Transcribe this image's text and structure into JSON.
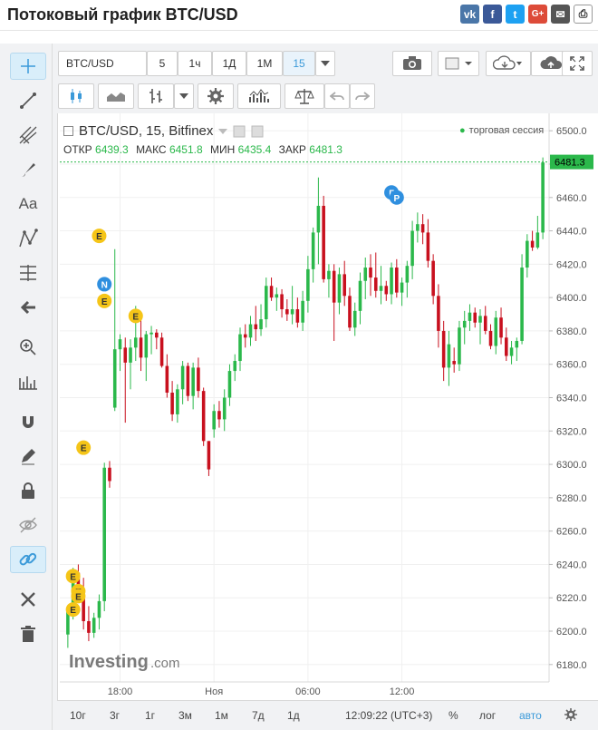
{
  "page_title": "Потоковый график BTC/USD",
  "share_icons": [
    "vk-icon",
    "facebook-icon",
    "twitter-icon",
    "google-plus-icon",
    "email-icon",
    "print-icon"
  ],
  "share_labels": {
    "vk": "vk",
    "fb": "f",
    "tw": "t",
    "gp": "G+",
    "em": "✉",
    "pr": "⎙"
  },
  "toolbar": {
    "symbol": "BTC/USD",
    "intervals": [
      "5",
      "1ч",
      "1Д",
      "1М",
      "15"
    ],
    "selected_interval": "15"
  },
  "legend": {
    "title": "BTC/USD, 15, Bitfinex",
    "open_label": "ОТКР",
    "open": "6439.3",
    "high_label": "МАКС",
    "high": "6451.8",
    "low_label": "МИН",
    "low": "6435.4",
    "close_label": "ЗАКР",
    "close": "6481.3",
    "session": "торговая сессия"
  },
  "watermark": {
    "brand": "Investing",
    "suffix": ".com"
  },
  "bottom_bar": {
    "ranges": [
      "10г",
      "3г",
      "1г",
      "3м",
      "1м",
      "7д",
      "1д"
    ],
    "time": "12:09:22 (UTC+3)",
    "percent": "%",
    "log": "лог",
    "auto": "авто"
  },
  "colors": {
    "up": "#2bb84b",
    "down": "#c8101e",
    "accent": "#3b9ad9",
    "event": "#f5c518",
    "news": "#2f8fdf"
  },
  "chart_data": {
    "type": "candlestick",
    "ylim": [
      6175,
      6505
    ],
    "y_ticks": [
      "6500.0",
      "6480.0",
      "6460.0",
      "6440.0",
      "6420.0",
      "6400.0",
      "6380.0",
      "6360.0",
      "6340.0",
      "6320.0",
      "6300.0",
      "6280.0",
      "6260.0",
      "6240.0",
      "6220.0",
      "6200.0",
      "6180.0"
    ],
    "x_ticks": [
      {
        "i": 10,
        "label": "18:00"
      },
      {
        "i": 28,
        "label": "Ноя"
      },
      {
        "i": 46,
        "label": "06:00"
      },
      {
        "i": 64,
        "label": "12:00"
      }
    ],
    "last_price": "6481.3",
    "candles": [
      [
        6198,
        6215,
        6190,
        6212
      ],
      [
        6212,
        6238,
        6207,
        6235
      ],
      [
        6235,
        6240,
        6218,
        6222
      ],
      [
        6222,
        6232,
        6201,
        6206
      ],
      [
        6206,
        6215,
        6194,
        6199
      ],
      [
        6199,
        6211,
        6196,
        6208
      ],
      [
        6208,
        6222,
        6201,
        6218
      ],
      [
        6218,
        6301,
        6212,
        6298
      ],
      [
        6298,
        6302,
        6286,
        6290
      ],
      [
        6334,
        6429,
        6332,
        6369
      ],
      [
        6369,
        6378,
        6356,
        6375
      ],
      [
        6370,
        6376,
        6325,
        6361
      ],
      [
        6361,
        6375,
        6345,
        6370
      ],
      [
        6370,
        6395,
        6362,
        6376
      ],
      [
        6376,
        6387,
        6356,
        6364
      ],
      [
        6364,
        6380,
        6350,
        6378
      ],
      [
        6378,
        6383,
        6366,
        6379
      ],
      [
        6379,
        6381,
        6369,
        6376
      ],
      [
        6376,
        6379,
        6358,
        6359
      ],
      [
        6359,
        6366,
        6340,
        6343
      ],
      [
        6343,
        6350,
        6326,
        6330
      ],
      [
        6330,
        6348,
        6325,
        6345
      ],
      [
        6345,
        6362,
        6336,
        6359
      ],
      [
        6359,
        6361,
        6338,
        6341
      ],
      [
        6341,
        6361,
        6333,
        6358
      ],
      [
        6358,
        6364,
        6340,
        6344
      ],
      [
        6344,
        6346,
        6311,
        6314
      ],
      [
        6314,
        6314,
        6293,
        6297
      ],
      [
        6321,
        6336,
        6316,
        6332
      ],
      [
        6332,
        6338,
        6322,
        6327
      ],
      [
        6327,
        6345,
        6320,
        6340
      ],
      [
        6340,
        6360,
        6335,
        6356
      ],
      [
        6356,
        6366,
        6350,
        6362
      ],
      [
        6362,
        6382,
        6356,
        6378
      ],
      [
        6378,
        6384,
        6370,
        6376
      ],
      [
        6376,
        6389,
        6371,
        6384
      ],
      [
        6384,
        6395,
        6374,
        6381
      ],
      [
        6381,
        6396,
        6377,
        6387
      ],
      [
        6387,
        6412,
        6382,
        6407
      ],
      [
        6407,
        6412,
        6398,
        6400
      ],
      [
        6400,
        6406,
        6392,
        6402
      ],
      [
        6402,
        6405,
        6388,
        6393
      ],
      [
        6393,
        6399,
        6386,
        6390
      ],
      [
        6390,
        6407,
        6384,
        6393
      ],
      [
        6393,
        6400,
        6382,
        6385
      ],
      [
        6385,
        6404,
        6380,
        6398
      ],
      [
        6398,
        6425,
        6391,
        6417
      ],
      [
        6417,
        6442,
        6409,
        6439
      ],
      [
        6439,
        6472,
        6420,
        6455
      ],
      [
        6455,
        6461,
        6409,
        6411
      ],
      [
        6411,
        6420,
        6400,
        6416
      ],
      [
        6416,
        6420,
        6374,
        6397
      ],
      [
        6397,
        6418,
        6390,
        6414
      ],
      [
        6414,
        6422,
        6395,
        6401
      ],
      [
        6401,
        6406,
        6380,
        6382
      ],
      [
        6382,
        6397,
        6377,
        6392
      ],
      [
        6392,
        6415,
        6384,
        6410
      ],
      [
        6410,
        6424,
        6399,
        6418
      ],
      [
        6418,
        6426,
        6401,
        6412
      ],
      [
        6412,
        6427,
        6400,
        6404
      ],
      [
        6404,
        6419,
        6396,
        6407
      ],
      [
        6407,
        6410,
        6398,
        6402
      ],
      [
        6402,
        6421,
        6396,
        6418
      ],
      [
        6418,
        6423,
        6400,
        6403
      ],
      [
        6403,
        6412,
        6395,
        6409
      ],
      [
        6409,
        6422,
        6400,
        6419
      ],
      [
        6419,
        6446,
        6411,
        6440
      ],
      [
        6440,
        6451,
        6433,
        6444
      ],
      [
        6444,
        6450,
        6432,
        6439
      ],
      [
        6439,
        6447,
        6418,
        6422
      ],
      [
        6422,
        6426,
        6396,
        6401
      ],
      [
        6401,
        6408,
        6370,
        6380
      ],
      [
        6380,
        6386,
        6350,
        6358
      ],
      [
        6358,
        6380,
        6347,
        6372
      ],
      [
        6362,
        6370,
        6355,
        6360
      ],
      [
        6360,
        6386,
        6356,
        6382
      ],
      [
        6382,
        6392,
        6372,
        6386
      ],
      [
        6386,
        6396,
        6380,
        6391
      ],
      [
        6391,
        6394,
        6382,
        6385
      ],
      [
        6385,
        6393,
        6372,
        6389
      ],
      [
        6389,
        6395,
        6378,
        6380
      ],
      [
        6380,
        6384,
        6369,
        6371
      ],
      [
        6371,
        6392,
        6366,
        6388
      ],
      [
        6388,
        6394,
        6372,
        6376
      ],
      [
        6376,
        6382,
        6362,
        6365
      ],
      [
        6365,
        6374,
        6360,
        6370
      ],
      [
        6370,
        6376,
        6362,
        6374
      ],
      [
        6374,
        6426,
        6372,
        6418
      ],
      [
        6418,
        6438,
        6412,
        6434
      ],
      [
        6434,
        6440,
        6428,
        6430
      ],
      [
        6430,
        6449,
        6429,
        6439
      ],
      [
        6439,
        6484,
        6435,
        6481
      ]
    ],
    "events": [
      {
        "i": 6,
        "label": "E",
        "kind": "event",
        "price": 6437
      },
      {
        "i": 7,
        "label": "N",
        "kind": "news",
        "price": 6408
      },
      {
        "i": 7,
        "label": "E",
        "kind": "event",
        "price": 6398
      },
      {
        "i": 13,
        "label": "E",
        "kind": "event",
        "price": 6389
      },
      {
        "i": 3,
        "label": "E",
        "kind": "event",
        "price": 6310
      },
      {
        "i": 1,
        "label": "E",
        "kind": "event",
        "price": 6233
      },
      {
        "i": 2,
        "label": "E",
        "kind": "event",
        "price": 6224
      },
      {
        "i": 2,
        "label": "E",
        "kind": "event",
        "price": 6221
      },
      {
        "i": 1,
        "label": "E",
        "kind": "event",
        "price": 6213
      },
      {
        "i": 62,
        "label": "Г",
        "kind": "news",
        "price": 6463
      },
      {
        "i": 63,
        "label": "Р",
        "kind": "news",
        "price": 6460
      }
    ]
  }
}
